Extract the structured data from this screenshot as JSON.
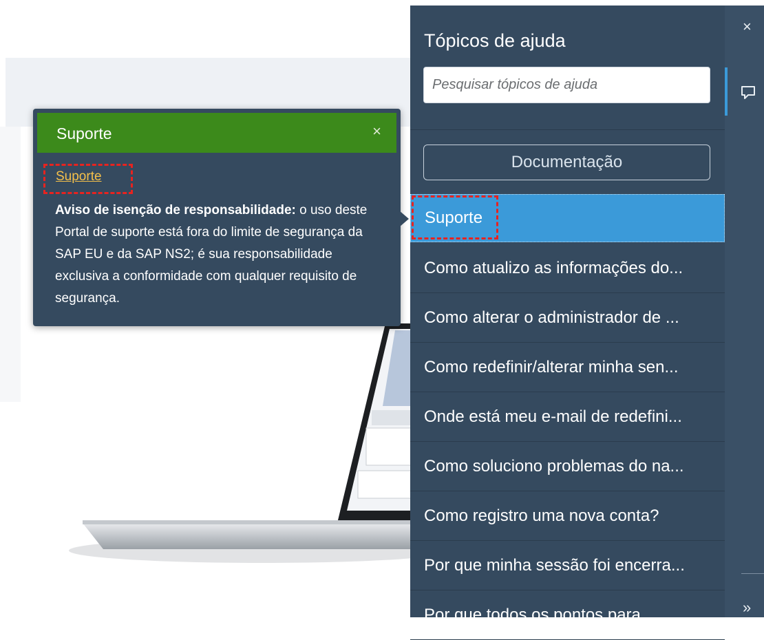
{
  "popover": {
    "title": "Suporte",
    "close_icon": "close-icon",
    "link": "Suporte",
    "disclaimer_label": "Aviso de isenção de responsabilidade:",
    "disclaimer_text": " o uso deste Portal de suporte está fora do limite de segurança da SAP EU e da SAP NS2; é sua responsabilidade exclusiva a conformidade com qualquer requisito de segurança."
  },
  "help_panel": {
    "title": "Tópicos de ajuda",
    "search_placeholder": "Pesquisar tópicos de ajuda",
    "documentation_button": "Documentação",
    "topics": [
      "Suporte",
      "Como atualizo as informações do...",
      "Como alterar o administrador de ...",
      "Como redefinir/alterar minha sen...",
      "Onde está meu e-mail de redefini...",
      "Como soluciono problemas do na...",
      "Como registro uma nova conta?",
      "Por que minha sessão foi encerra...",
      "Por que todos os pontos para..."
    ],
    "selected_topic_index": 0
  },
  "rail": {
    "close_icon": "close-icon",
    "chat_icon": "chat-bubble-icon",
    "expand_icon": "double-chevron-right-icon",
    "close_glyph": "×",
    "expand_glyph": "»"
  },
  "colors": {
    "panel_bg": "#354a5f",
    "header_green": "#3c8a1b",
    "selected_blue": "#3b9ad9",
    "link_yellow": "#f5c04a",
    "highlight_red": "#e8231f"
  }
}
